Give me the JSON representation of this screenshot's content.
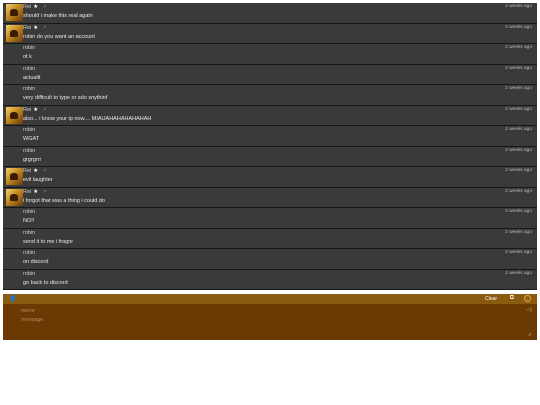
{
  "messages": [
    {
      "name": "Rei",
      "text": "should i make this real again",
      "time": "2 weeks ago",
      "avatar": true
    },
    {
      "name": "Rei",
      "text": "robin do you want an account",
      "time": "2 weeks ago",
      "avatar": true
    },
    {
      "name": "robin",
      "text": "ot k",
      "time": "2 weeks ago",
      "avatar": false
    },
    {
      "name": "robin",
      "text": "actuallt",
      "time": "2 weeks ago",
      "avatar": false
    },
    {
      "name": "robin",
      "text": "very difficult to type or sdo snythinf",
      "time": "2 weeks ago",
      "avatar": false
    },
    {
      "name": "Rei",
      "text": "also... i know your ip now.... MIAUAHAHAHAHAHAH",
      "time": "2 weeks ago",
      "avatar": true
    },
    {
      "name": "robin",
      "text": "WGAT",
      "time": "2 weeks ago",
      "avatar": false
    },
    {
      "name": "robin",
      "text": "grgrgrrr",
      "time": "2 weeks ago",
      "avatar": false
    },
    {
      "name": "Rei",
      "text": "evil laughter",
      "time": "2 weeks ago",
      "avatar": true
    },
    {
      "name": "Rei",
      "text": "i forgot that was a thing i could do",
      "time": "2 weeks ago",
      "avatar": true
    },
    {
      "name": "robin",
      "text": "NO!!",
      "time": "2 weeks ago",
      "avatar": false
    },
    {
      "name": "robin",
      "text": "send it to me i frogor",
      "time": "2 weeks ago",
      "avatar": false
    },
    {
      "name": "robin",
      "text": "on discord",
      "time": "2 weeks ago",
      "avatar": false
    },
    {
      "name": "robin",
      "text": "go back to discord",
      "time": "2 weeks ago",
      "avatar": false
    }
  ],
  "icons": {
    "star": "★",
    "external": "↗",
    "user": "👤",
    "popout": "⧉",
    "info": "i",
    "volume": "◁)",
    "resize_grip": "◢"
  },
  "toolbar": {
    "clear_label": "Clear"
  },
  "compose": {
    "name_placeholder": "name",
    "message_placeholder": "message"
  },
  "colors": {
    "message_bg": "#3a3a3a",
    "toolbar_bg": "#8a5a0e",
    "compose_bg": "#6b3a04",
    "external_link": "#d07a2a"
  }
}
